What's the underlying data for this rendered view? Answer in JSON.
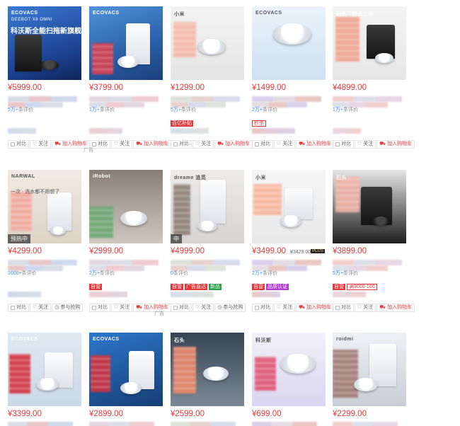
{
  "ui": {
    "action_compare": "对比",
    "action_follow": "关注",
    "action_cart": "加入购物车",
    "action_group": "参与抢购",
    "ad_label": "广告",
    "reviews_suffix": "条评价"
  },
  "products": [
    {
      "price": "¥5999.00",
      "img_brand": "ECOVACS",
      "img_headline": "科沃斯全能扫拖新旗舰",
      "img_sub": "DEEBOT X8 OMNI",
      "reviews": "5万+",
      "show_follow": true,
      "cart": true
    },
    {
      "price": "¥3799.00",
      "img_brand": "ECOVACS",
      "reviews": "1万+",
      "cart": true
    },
    {
      "price": "¥1299.00",
      "img_brand": "小米",
      "reviews": "5万+",
      "cart": true,
      "tags": [
        "百亿补贴"
      ]
    },
    {
      "price": "¥1499.00",
      "img_brand": "ECOVACS",
      "reviews": "2万+",
      "cart": true,
      "tags": [
        "秒杀"
      ]
    },
    {
      "price": "¥4899.00",
      "img_brand": "石头 · 新品上市",
      "reviews": "1万+",
      "cart": true
    },
    {
      "price": "¥4299.00",
      "img_brand": "NARWAL",
      "img_headline": "一次 · 洗水都不用想了",
      "img_corner": "预热中",
      "reviews": "1000+",
      "group": true
    },
    {
      "price": "¥2999.00",
      "img_brand": "iRobot",
      "reviews": "2万+",
      "cart": true,
      "tags": [
        "自营"
      ]
    },
    {
      "price": "¥4999.00",
      "img_brand": "dreame 追觅",
      "img_corner": "中",
      "reviews": "0",
      "group": true,
      "tags": [
        "自营",
        "广告直达",
        "新品"
      ]
    },
    {
      "price": "¥3499.00",
      "price_sub": "¥3429.00",
      "price_badge": "PLUS",
      "img_brand": "小米",
      "reviews": "2万+",
      "cart": true,
      "tags": [
        "自营",
        "品质认证"
      ]
    },
    {
      "price": "¥3899.00",
      "img_brand": "石头",
      "reviews": "5万+",
      "cart": true,
      "tags": [
        "自营",
        "满3000-100"
      ]
    },
    {
      "price": "¥3399.00",
      "img_brand": "ECOVACS"
    },
    {
      "price": "¥2899.00",
      "img_brand": "ECOVACS"
    },
    {
      "price": "¥2599.00",
      "img_brand": "石头"
    },
    {
      "price": "¥699.00",
      "img_brand": "科沃斯"
    },
    {
      "price": "¥2299.00",
      "img_brand": "roidmi"
    }
  ]
}
